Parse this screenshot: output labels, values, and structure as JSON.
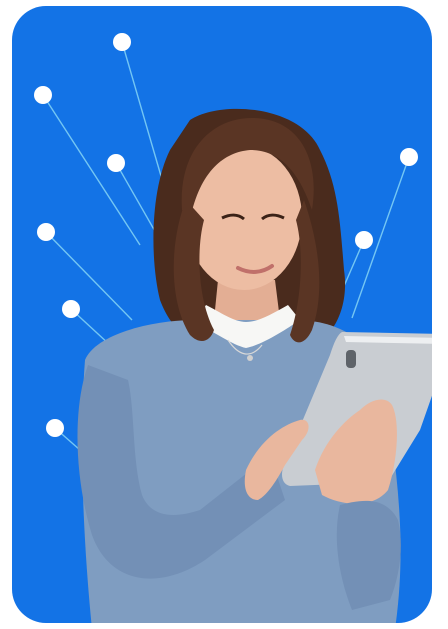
{
  "colors": {
    "card_bg": "#1373E6",
    "line": "#7FD0F5",
    "dot": "#FFFFFF",
    "sweater": "#7F9DC1",
    "sweater_shadow": "#6A88AE",
    "hair": "#5A3524",
    "hair_dark": "#3B2217",
    "skin": "#E9B79E",
    "collar": "#F7F7F5",
    "tablet": "#C9CDD2",
    "tablet_edge": "#EDEFF1",
    "tablet_screen_back": "#B7BCC2"
  },
  "illustration": {
    "subject": "person-holding-tablet",
    "decor": "network-nodes"
  }
}
